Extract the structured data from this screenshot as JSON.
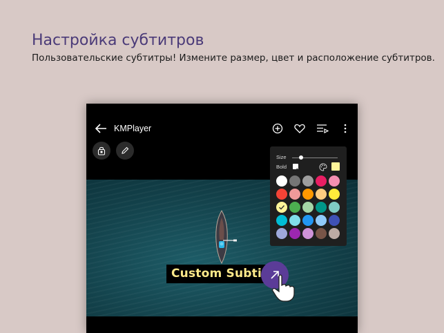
{
  "promo": {
    "title": "Настройка субтитров",
    "subtitle": "Пользовательские субтитры! Измените размер, цвет и расположение субтитров."
  },
  "app": {
    "title": "KMPlayer",
    "toolbar_icons": [
      "back-arrow-icon",
      "add-circle-icon",
      "heart-icon",
      "playlist-icon",
      "more-vertical-icon"
    ],
    "quick_buttons": [
      "lock-icon",
      "pencil-icon"
    ]
  },
  "video": {
    "subtitle_text": "Custom Subtitle"
  },
  "subtitle_panel": {
    "size_label": "Size",
    "bold_label": "Bold",
    "size_value": 0.2,
    "bold_checked": true,
    "selected_color": "#fff59a",
    "swatches": [
      "#ffffff",
      "#757575",
      "#9e9e9e",
      "#e91e63",
      "#f48fb1",
      "#f44336",
      "#ef9a9a",
      "#ff9800",
      "#ffcc80",
      "#ffeb3b",
      "#fff59a",
      "#4caf50",
      "#a5d6a7",
      "#009688",
      "#80cbc4",
      "#00bcd4",
      "#80deea",
      "#2196f3",
      "#90caf9",
      "#3f51b5",
      "#9fa8da",
      "#9c27b0",
      "#ce93d8",
      "#795548",
      "#bcaaa4"
    ],
    "selected_index": 10
  },
  "colors": {
    "accent": "#5b3c98",
    "subtitle_color": "#fde98a",
    "promo_title": "#4a3a78"
  }
}
